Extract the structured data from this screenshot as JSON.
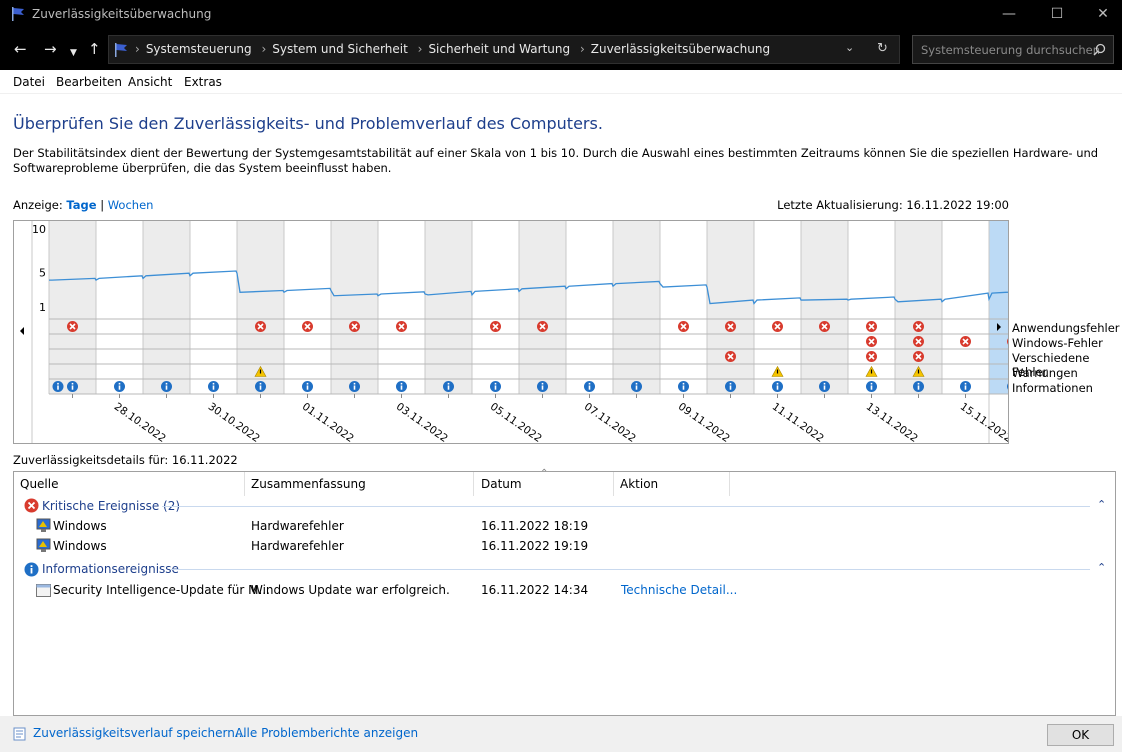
{
  "window": {
    "title": "Zuverlässigkeitsüberwachung"
  },
  "addressbar": {
    "crumbs": [
      "Systemsteuerung",
      "System und Sicherheit",
      "Sicherheit und Wartung",
      "Zuverlässigkeitsüberwachung"
    ],
    "search_placeholder": "Systemsteuerung durchsuchen"
  },
  "menu": [
    "Datei",
    "Bearbeiten",
    "Ansicht",
    "Extras"
  ],
  "heading": "Überprüfen Sie den Zuverlässigkeits- und Problemverlauf des Computers.",
  "description": "Der Stabilitätsindex dient der Bewertung der Systemgesamtstabilität auf einer Skala von 1 bis 10. Durch die Auswahl eines bestimmten Zeitraums können Sie die speziellen Hardware- und Softwareprobleme überprüfen, die das System beeinflusst haben.",
  "view": {
    "label": "Anzeige:",
    "days": "Tage",
    "sep": "|",
    "weeks": "Wochen"
  },
  "last_update": "Letzte Aktualisierung: 16.11.2022 19:00",
  "chart_data": {
    "type": "line",
    "y_ticks": [
      "10",
      "5",
      "1"
    ],
    "ylim": [
      1,
      10
    ],
    "x": [
      "27.10.2022",
      "28.10.2022",
      "29.10.2022",
      "30.10.2022",
      "31.10.2022",
      "01.11.2022",
      "02.11.2022",
      "03.11.2022",
      "04.11.2022",
      "05.11.2022",
      "06.11.2022",
      "07.11.2022",
      "08.11.2022",
      "09.11.2022",
      "10.11.2022",
      "11.11.2022",
      "12.11.2022",
      "13.11.2022",
      "14.11.2022",
      "15.11.2022",
      "16.11.2022"
    ],
    "x_tick_labels": [
      "28.10.2022",
      "30.10.2022",
      "01.11.2022",
      "03.11.2022",
      "05.11.2022",
      "07.11.2022",
      "09.11.2022",
      "11.11.2022",
      "13.11.2022",
      "15.11.2022"
    ],
    "stability": [
      4.1,
      4.3,
      4.6,
      4.9,
      2.7,
      2.9,
      2.3,
      2.5,
      2.4,
      2.8,
      3.1,
      3.4,
      3.7,
      3.3,
      1.4,
      1.8,
      1.8,
      1.9,
      1.6,
      1.9,
      2.6
    ],
    "selected_index": 20,
    "rows": [
      "Anwendungsfehler",
      "Windows-Fehler",
      "Verschiedene Fehler",
      "Warnungen",
      "Informationen"
    ],
    "events": {
      "Anwendungsfehler": [
        0,
        4,
        5,
        6,
        7,
        9,
        10,
        13,
        14,
        15,
        16,
        17,
        18
      ],
      "Windows-Fehler": [
        17,
        18,
        19,
        20
      ],
      "Verschiedene Fehler": [
        14,
        17,
        18
      ],
      "Warnungen": [
        4,
        15,
        17,
        18
      ],
      "Informationen": [
        0,
        1,
        2,
        3,
        4,
        5,
        6,
        7,
        8,
        9,
        10,
        11,
        12,
        13,
        14,
        15,
        16,
        17,
        18,
        19,
        20
      ]
    },
    "extra_info_index": 0
  },
  "details_label": "Zuverlässigkeitsdetails für: 16.11.2022",
  "table": {
    "columns": [
      "Quelle",
      "Zusammenfassung",
      "Datum",
      "Aktion"
    ],
    "groups": [
      {
        "title": "Kritische Ereignisse (2)",
        "rows": [
          {
            "source": "Windows",
            "summary": "Hardwarefehler",
            "date": "16.11.2022 18:19",
            "action": ""
          },
          {
            "source": "Windows",
            "summary": "Hardwarefehler",
            "date": "16.11.2022 19:19",
            "action": ""
          }
        ]
      },
      {
        "title": "Informationsereignisse",
        "rows": [
          {
            "source": "Security Intelligence-Update für M...",
            "summary": "Windows Update war erfolgreich.",
            "date": "16.11.2022 14:34",
            "action": "Technische Detail..."
          }
        ]
      }
    ]
  },
  "footer": {
    "save_link": "Zuverlässigkeitsverlauf speichern...",
    "reports_link": "Alle Problemberichte anzeigen",
    "ok": "OK"
  },
  "colors": {
    "error": "#d83b2e",
    "info": "#1f6fc5",
    "warning": "#f5c400",
    "line": "#3d8fd6",
    "selected": "#bcdaf5",
    "heading": "#1e3f8c",
    "link": "#0066cc"
  }
}
